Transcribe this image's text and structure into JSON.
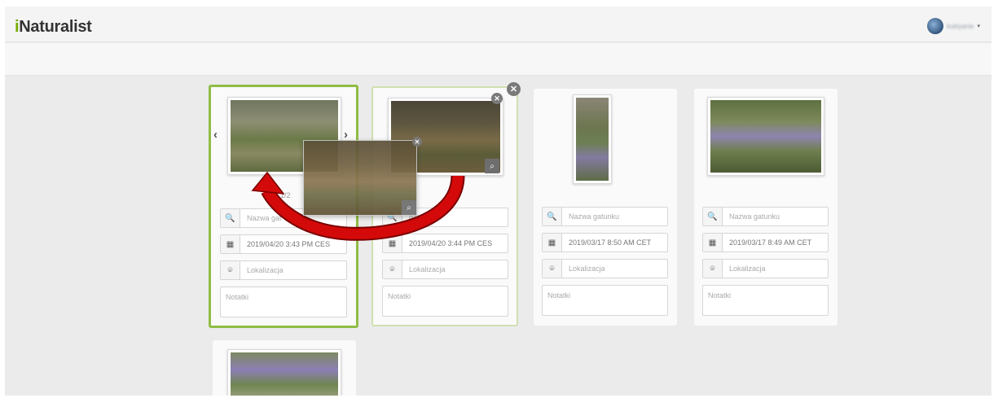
{
  "header": {
    "brand_initial": "i",
    "brand_rest": "Naturalist",
    "user_name": "kuklyanie",
    "caret": "▾"
  },
  "icons": {
    "search": "🔍",
    "calendar": "▦",
    "location": "⌾",
    "zoom": "⌕",
    "close": "✕",
    "prev": "‹",
    "next": "›"
  },
  "placeholders": {
    "species": "Nazwa gatunku",
    "location": "Lokalizacja",
    "notes": "Notatki"
  },
  "cards": [
    {
      "date": "2019/04/20 3:43 PM CES",
      "species_partial": "Nazwa gat",
      "caption_fragment": "1/2"
    },
    {
      "date": "2019/04/20 3:44 PM CES",
      "species_partial": "gatunku"
    },
    {
      "date": "2019/03/17 8:50 AM CET"
    },
    {
      "date": "2019/03/17 8:49 AM CET"
    }
  ],
  "colors": {
    "accent": "#74ac00",
    "selected_border": "#8fbd45",
    "arrow_red": "#d40a0a"
  }
}
